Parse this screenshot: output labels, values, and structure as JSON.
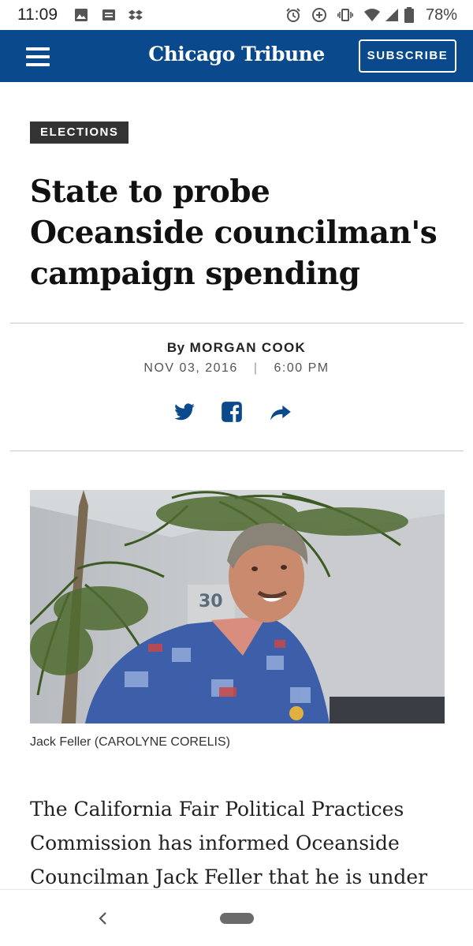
{
  "status_bar": {
    "time": "11:09",
    "battery": "78%",
    "icons": [
      "image-icon",
      "message-icon",
      "dropbox-icon",
      "alarm-icon",
      "data-saver-icon",
      "vibrate-icon",
      "wifi-icon",
      "signal-icon",
      "battery-icon"
    ]
  },
  "header": {
    "logo": "Chicago Tribune",
    "subscribe_label": "SUBSCRIBE",
    "background_color": "#0a4a8c"
  },
  "article": {
    "section": "ELECTIONS",
    "headline": "State to probe Oceanside councilman's campaign spending",
    "byline_prefix": "By",
    "author": "MORGAN COOK",
    "date": "NOV 03, 2016",
    "time_sep": "|",
    "time": "6:00 PM",
    "share_icons": [
      "twitter-icon",
      "facebook-icon",
      "share-icon"
    ],
    "photo_caption": "Jack Feller (CAROLYNE CORELIS)",
    "body_text": "The California Fair Political Practices Commission has informed Oceanside Councilman Jack Feller that he is under"
  },
  "nav": {
    "icons": [
      "back-icon",
      "home-pill"
    ]
  }
}
